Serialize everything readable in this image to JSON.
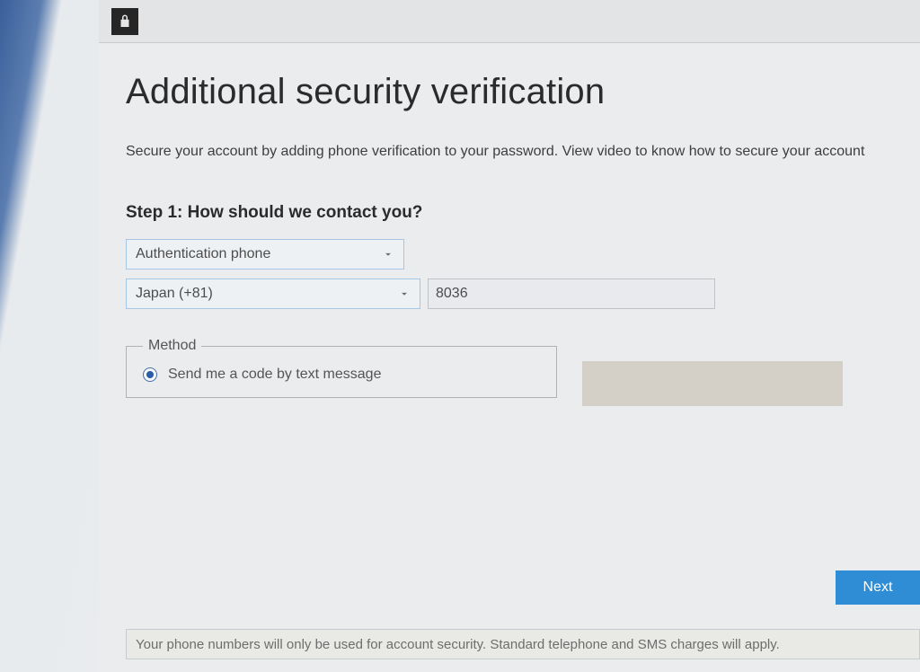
{
  "header": {
    "icon": "lock-icon"
  },
  "page": {
    "title": "Additional security verification",
    "subtitle": "Secure your account by adding phone verification to your password. View video to know how to secure your account",
    "step_heading": "Step 1: How should we contact you?"
  },
  "form": {
    "contact_method_selected": "Authentication phone",
    "country_selected": "Japan (+81)",
    "phone_value": "8036",
    "method_legend": "Method",
    "method_option_sms": "Send me a code by text message"
  },
  "actions": {
    "next_label": "Next"
  },
  "footer": {
    "note": "Your phone numbers will only be used for account security. Standard telephone and SMS charges will apply."
  }
}
